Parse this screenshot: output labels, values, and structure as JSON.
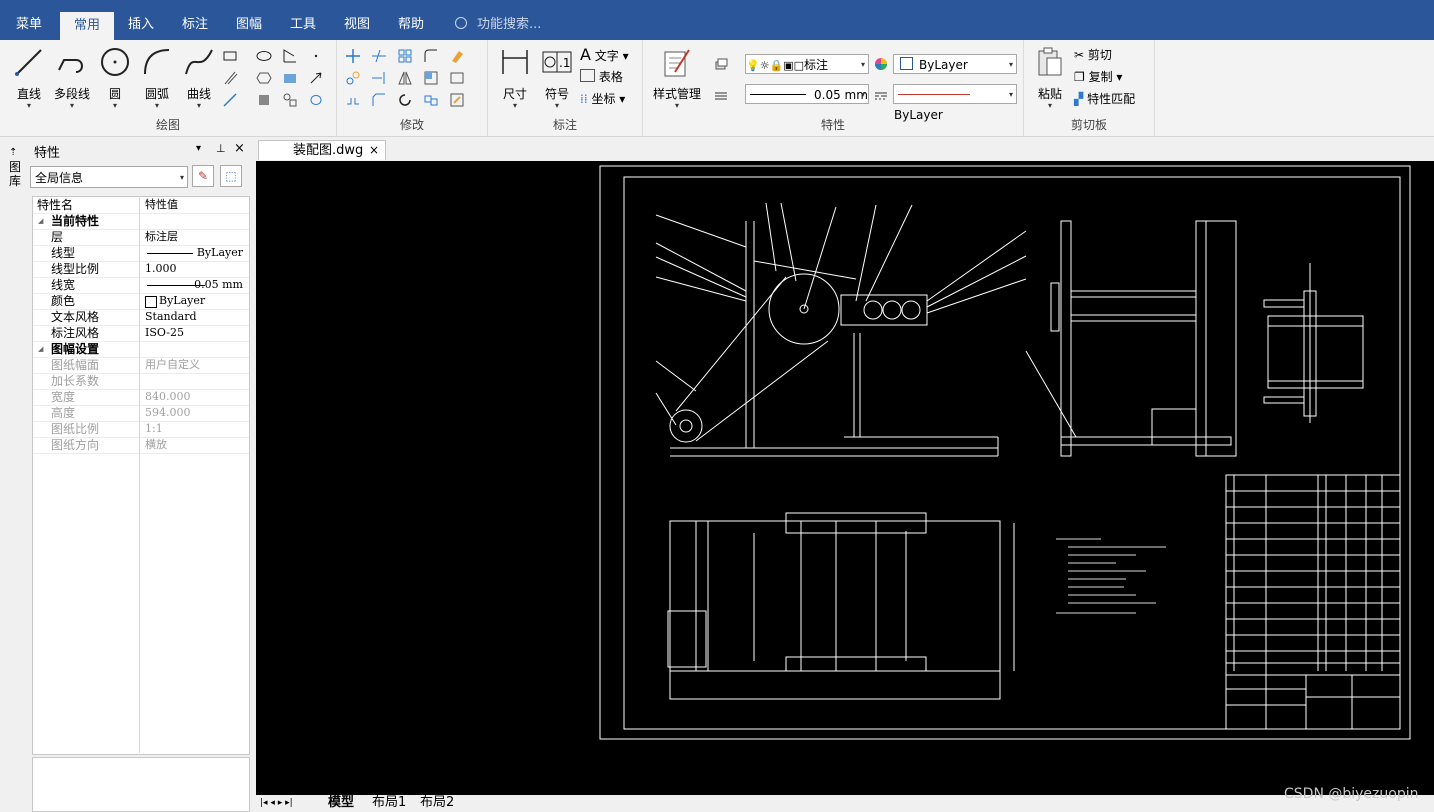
{
  "menubar": {
    "items": [
      "菜单",
      "常用",
      "插入",
      "标注",
      "图幅",
      "工具",
      "视图",
      "帮助"
    ],
    "active": "常用",
    "search_placeholder": "功能搜索..."
  },
  "ribbon": {
    "draw": {
      "label": "绘图",
      "line": "直线",
      "polyline": "多段线",
      "circle": "圆",
      "arc": "圆弧",
      "curve": "曲线"
    },
    "modify": {
      "label": "修改"
    },
    "annotate": {
      "label": "标注",
      "dimension": "尺寸",
      "symbol": "符号",
      "text": "文字",
      "table": "表格",
      "coordinate": "坐标"
    },
    "properties": {
      "label": "特性",
      "style_manager": "样式管理",
      "layer_value": "标注",
      "color_value": "ByLayer",
      "lineweight_value": "0.05 mm",
      "linetype_value": "ByLayer"
    },
    "clipboard": {
      "label": "剪切板",
      "paste": "粘贴",
      "cut": "剪切",
      "copy": "复制",
      "match": "特性匹配"
    }
  },
  "panel": {
    "title": "特性",
    "side_tab": "图库",
    "selector": "全局信息",
    "col_name": "特性名",
    "col_value": "特性值",
    "sections": [
      {
        "title": "当前特性",
        "rows": [
          {
            "name": "层",
            "value": "标注层"
          },
          {
            "name": "线型",
            "value": "ByLayer"
          },
          {
            "name": "线型比例",
            "value": "1.000"
          },
          {
            "name": "线宽",
            "value": "0.05 mm"
          },
          {
            "name": "颜色",
            "value": "ByLayer"
          },
          {
            "name": "文本风格",
            "value": "Standard"
          },
          {
            "name": "标注风格",
            "value": "ISO-25"
          }
        ]
      },
      {
        "title": "图幅设置",
        "rows": [
          {
            "name": "图纸幅面",
            "value": "用户自定义"
          },
          {
            "name": "加长系数",
            "value": ""
          },
          {
            "name": "宽度",
            "value": "840.000"
          },
          {
            "name": "高度",
            "value": "594.000"
          },
          {
            "name": "图纸比例",
            "value": "1:1"
          },
          {
            "name": "图纸方向",
            "value": "横放"
          }
        ]
      }
    ]
  },
  "document": {
    "tab": "装配图.dwg"
  },
  "layout_tabs": [
    "模型",
    "布局1",
    "布局2"
  ],
  "active_layout": "模型",
  "watermark": "CSDN @biyezuopin",
  "colors": {
    "accent": "#2b579a",
    "canvas": "#000000",
    "line": "#ffffff"
  }
}
